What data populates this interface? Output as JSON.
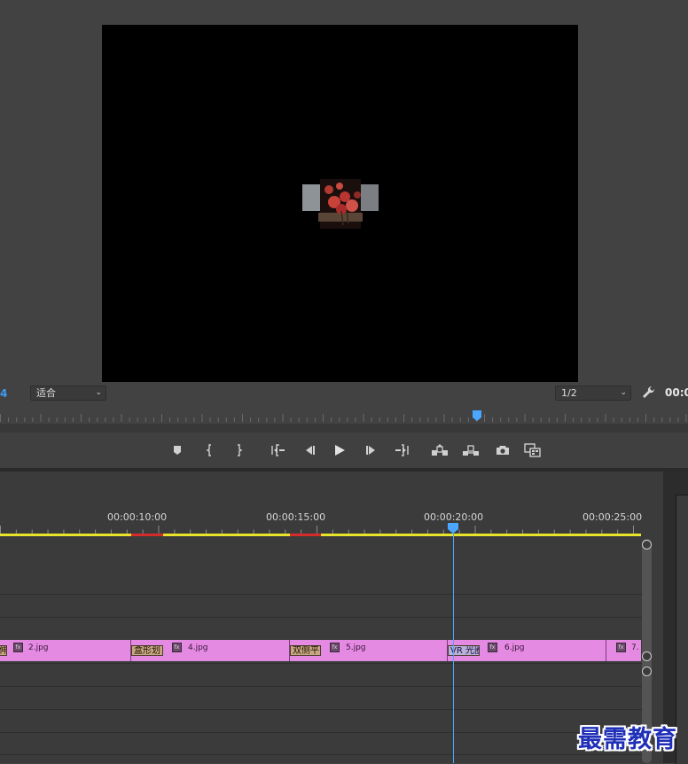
{
  "monitor": {
    "zoom_left_fragment": "4",
    "fit_dropdown": {
      "selected": "适合"
    },
    "resolution_dropdown": {
      "selected": "1/2"
    },
    "timecode_right_fragment": "00:0",
    "playback_position": 0.693
  },
  "transport_buttons": [
    {
      "name": "add-marker-button",
      "icon": "marker-icon"
    },
    {
      "name": "mark-in-button",
      "icon": "mark-in-icon"
    },
    {
      "name": "mark-out-button",
      "icon": "mark-out-icon"
    },
    {
      "name": "go-to-in-button",
      "icon": "go-to-in-icon"
    },
    {
      "name": "step-back-button",
      "icon": "step-back-icon"
    },
    {
      "name": "play-button",
      "icon": "play-icon"
    },
    {
      "name": "step-forward-button",
      "icon": "step-forward-icon"
    },
    {
      "name": "go-to-out-button",
      "icon": "go-to-out-icon"
    },
    {
      "name": "lift-button",
      "icon": "lift-icon"
    },
    {
      "name": "extract-button",
      "icon": "extract-icon"
    },
    {
      "name": "export-frame-button",
      "icon": "camera-icon"
    },
    {
      "name": "compare-view-button",
      "icon": "compare-icon"
    }
  ],
  "timeline": {
    "timecodes": [
      "00:00:10:00",
      "00:00:15:00",
      "00:00:20:00",
      "00:00:25:00"
    ],
    "playhead_timecode_index": 2,
    "clips": [
      {
        "name": "2.jpg",
        "fx": "fx"
      },
      {
        "name": "4.jpg",
        "fx": "fx"
      },
      {
        "name": "5.jpg",
        "fx": "fx"
      },
      {
        "name": "6.jpg",
        "fx": "fx"
      },
      {
        "name": "7.",
        "fx": "fx"
      }
    ],
    "transitions": [
      {
        "label": "伸"
      },
      {
        "label": "盒形划"
      },
      {
        "label": "双侧平"
      },
      {
        "label": "VR 光圈"
      }
    ]
  },
  "colors": {
    "clip": "#e48ae3",
    "playhead": "#4aa6ff",
    "work_area": "#e8e42a",
    "render_bar_red": "#d52b2b",
    "watermark": "#1f2fb8"
  },
  "watermark": "最需教育"
}
